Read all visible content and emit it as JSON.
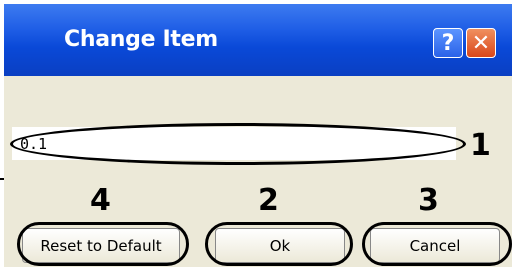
{
  "dialog": {
    "title": "Change Item",
    "help_label": "?",
    "close_label": "✕",
    "value": "0.1"
  },
  "buttons": {
    "reset_label": "Reset to Default",
    "ok_label": "Ok",
    "cancel_label": "Cancel"
  },
  "annotations": {
    "input_number": "1",
    "ok_number": "2",
    "cancel_number": "3",
    "reset_number": "4"
  },
  "colors": {
    "titlebar": "#0a49d8",
    "body": "#ece9d8",
    "close": "#d9471b"
  },
  "icons": {
    "help": "help-icon",
    "close": "close-icon"
  }
}
